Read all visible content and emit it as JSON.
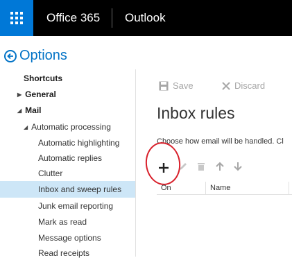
{
  "topbar": {
    "brand": "Office 365",
    "app": "Outlook"
  },
  "options": {
    "title": "Options"
  },
  "sidebar": {
    "items": [
      {
        "label": "Shortcuts"
      },
      {
        "label": "General"
      },
      {
        "label": "Mail"
      },
      {
        "label": "Automatic processing"
      },
      {
        "label": "Automatic highlighting"
      },
      {
        "label": "Automatic replies"
      },
      {
        "label": "Clutter"
      },
      {
        "label": "Inbox and sweep rules"
      },
      {
        "label": "Junk email reporting"
      },
      {
        "label": "Mark as read"
      },
      {
        "label": "Message options"
      },
      {
        "label": "Read receipts"
      }
    ]
  },
  "toolbar": {
    "save_label": "Save",
    "discard_label": "Discard"
  },
  "main": {
    "title": "Inbox rules",
    "description": "Choose how email will be handled. Cl"
  },
  "table": {
    "columns": [
      "On",
      "Name"
    ]
  },
  "colors": {
    "accent": "#0072c6",
    "waffle": "#0078d7",
    "selected": "#cde6f7",
    "annotation": "#d81f2a"
  }
}
